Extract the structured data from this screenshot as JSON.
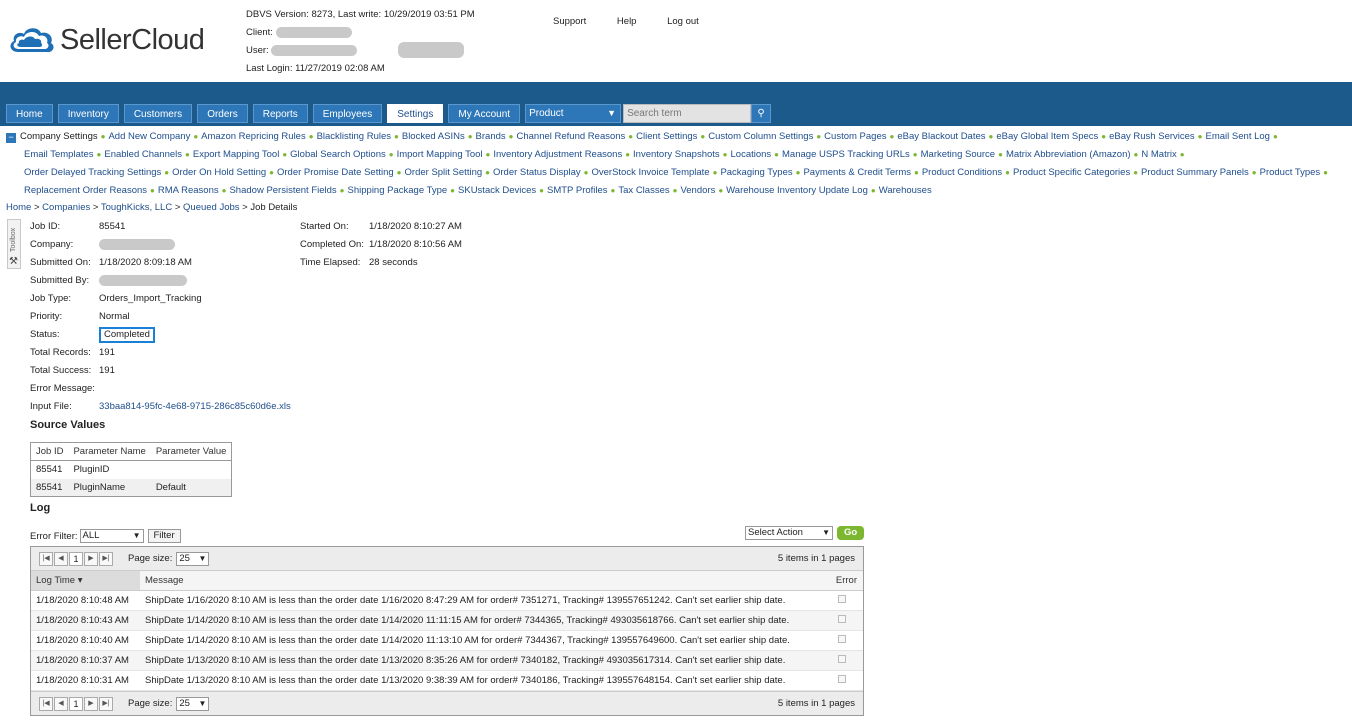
{
  "brand": {
    "name": "SellerCloud"
  },
  "header": {
    "version_line": "DBVS Version: 8273, Last write: 10/29/2019 03:51 PM",
    "client_label": "Client:",
    "user_label": "User:",
    "last_login": "Last Login: 11/27/2019 02:08 AM",
    "links": [
      "Support",
      "Help",
      "Log out"
    ]
  },
  "nav": {
    "tabs": [
      "Home",
      "Inventory",
      "Customers",
      "Orders",
      "Reports",
      "Employees",
      "Settings",
      "My Account"
    ],
    "active_tab": "Settings",
    "product_select": "Product",
    "search_placeholder": "Search term"
  },
  "settings_links": [
    "Company Settings",
    "Add New Company",
    "Amazon Repricing Rules",
    "Blacklisting Rules",
    "Blocked ASINs",
    "Brands",
    "Channel Refund Reasons",
    "Client Settings",
    "Custom Column Settings",
    "Custom Pages",
    "eBay Blackout Dates",
    "eBay Global Item Specs",
    "eBay Rush Services",
    "Email Sent Log",
    "Email Templates",
    "Enabled Channels",
    "Export Mapping Tool",
    "Global Search Options",
    "Import Mapping Tool",
    "Inventory Adjustment Reasons",
    "Inventory Snapshots",
    "Locations",
    "Manage USPS Tracking URLs",
    "Marketing Source",
    "Matrix Abbreviation (Amazon)",
    "N Matrix",
    "Order Delayed Tracking Settings",
    "Order On Hold Setting",
    "Order Promise Date Setting",
    "Order Split Setting",
    "Order Status Display",
    "OverStock Invoice Template",
    "Packaging Types",
    "Payments & Credit Terms",
    "Product Conditions",
    "Product Specific Categories",
    "Product Summary Panels",
    "Product Types",
    "Replacement Order Reasons",
    "RMA Reasons",
    "Shadow Persistent Fields",
    "Shipping Package Type",
    "SKUstack Devices",
    "SMTP Profiles",
    "Tax Classes",
    "Vendors",
    "Warehouse Inventory Update Log",
    "Warehouses"
  ],
  "breadcrumb": {
    "items": [
      "Home",
      "Companies",
      "ToughKicks, LLC",
      "Queued Jobs"
    ],
    "current": "Job Details",
    "sep": " > "
  },
  "toolbox": {
    "label": "Toolbox"
  },
  "job": {
    "id_label": "Job ID:",
    "id": "85541",
    "company_label": "Company:",
    "submitted_on_label": "Submitted On:",
    "submitted_on": "1/18/2020 8:09:18 AM",
    "submitted_by_label": "Submitted By:",
    "type_label": "Job Type:",
    "type": "Orders_Import_Tracking",
    "priority_label": "Priority:",
    "priority": "Normal",
    "status_label": "Status:",
    "status": "Completed",
    "total_records_label": "Total Records:",
    "total_records": "191",
    "total_success_label": "Total Success:",
    "total_success": "191",
    "error_message_label": "Error Message:",
    "input_file_label": "Input File:",
    "input_file": "33baa814-95fc-4e68-9715-286c85c60d6e.xls",
    "started_on_label": "Started On:",
    "started_on": "1/18/2020 8:10:27 AM",
    "completed_on_label": "Completed On:",
    "completed_on": "1/18/2020 8:10:56 AM",
    "elapsed_label": "Time Elapsed:",
    "elapsed": "28 seconds"
  },
  "source_values": {
    "title": "Source Values",
    "headers": [
      "Job ID",
      "Parameter Name",
      "Parameter Value"
    ],
    "rows": [
      [
        "85541",
        "PluginID",
        ""
      ],
      [
        "85541",
        "PluginName",
        "Default"
      ]
    ]
  },
  "log": {
    "title": "Log",
    "error_filter_label": "Error Filter:",
    "error_filter_value": "ALL",
    "filter_button": "Filter",
    "action_select": "Select Action",
    "go_button": "Go",
    "page_number": "1",
    "page_size_label": "Page size:",
    "page_size": "25",
    "page_info": "5 items in 1 pages",
    "headers": {
      "time": "Log Time",
      "message": "Message",
      "error": "Error"
    },
    "rows": [
      {
        "time": "1/18/2020 8:10:48 AM",
        "message": "ShipDate 1/16/2020 8:10 AM is less than the order date 1/16/2020 8:47:29 AM for order# 7351271, Tracking# 139557651242. Can't set earlier ship date."
      },
      {
        "time": "1/18/2020 8:10:43 AM",
        "message": "ShipDate 1/14/2020 8:10 AM is less than the order date 1/14/2020 11:11:15 AM for order# 7344365, Tracking# 493035618766. Can't set earlier ship date."
      },
      {
        "time": "1/18/2020 8:10:40 AM",
        "message": "ShipDate 1/14/2020 8:10 AM is less than the order date 1/14/2020 11:13:10 AM for order# 7344367, Tracking# 139557649600. Can't set earlier ship date."
      },
      {
        "time": "1/18/2020 8:10:37 AM",
        "message": "ShipDate 1/13/2020 8:10 AM is less than the order date 1/13/2020 8:35:26 AM for order# 7340182, Tracking# 493035617314. Can't set earlier ship date."
      },
      {
        "time": "1/18/2020 8:10:31 AM",
        "message": "ShipDate 1/13/2020 8:10 AM is less than the order date 1/13/2020 9:38:39 AM for order# 7340186, Tracking# 139557648154. Can't set earlier ship date."
      }
    ]
  }
}
